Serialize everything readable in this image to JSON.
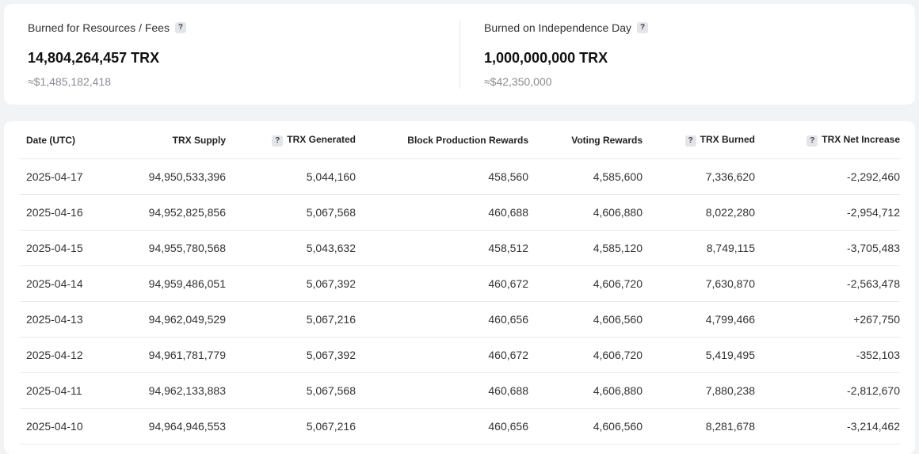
{
  "stats": {
    "resources": {
      "label": "Burned for Resources / Fees",
      "value": "14,804,264,457 TRX",
      "usd": "≈$1,485,182,418"
    },
    "independence": {
      "label": "Burned on Independence Day",
      "value": "1,000,000,000 TRX",
      "usd": "≈$42,350,000"
    },
    "help_glyph": "?"
  },
  "table": {
    "headers": {
      "date": "Date (UTC)",
      "supply": "TRX Supply",
      "generated": "TRX Generated",
      "block_rewards": "Block Production Rewards",
      "voting_rewards": "Voting Rewards",
      "burned": "TRX Burned",
      "net_increase": "TRX Net Increase"
    },
    "rows": [
      {
        "date": "2025-04-17",
        "supply": "94,950,533,396",
        "generated": "5,044,160",
        "block_rewards": "458,560",
        "voting_rewards": "4,585,600",
        "burned": "7,336,620",
        "net_increase": "-2,292,460"
      },
      {
        "date": "2025-04-16",
        "supply": "94,952,825,856",
        "generated": "5,067,568",
        "block_rewards": "460,688",
        "voting_rewards": "4,606,880",
        "burned": "8,022,280",
        "net_increase": "-2,954,712"
      },
      {
        "date": "2025-04-15",
        "supply": "94,955,780,568",
        "generated": "5,043,632",
        "block_rewards": "458,512",
        "voting_rewards": "4,585,120",
        "burned": "8,749,115",
        "net_increase": "-3,705,483"
      },
      {
        "date": "2025-04-14",
        "supply": "94,959,486,051",
        "generated": "5,067,392",
        "block_rewards": "460,672",
        "voting_rewards": "4,606,720",
        "burned": "7,630,870",
        "net_increase": "-2,563,478"
      },
      {
        "date": "2025-04-13",
        "supply": "94,962,049,529",
        "generated": "5,067,216",
        "block_rewards": "460,656",
        "voting_rewards": "4,606,560",
        "burned": "4,799,466",
        "net_increase": "+267,750"
      },
      {
        "date": "2025-04-12",
        "supply": "94,961,781,779",
        "generated": "5,067,392",
        "block_rewards": "460,672",
        "voting_rewards": "4,606,720",
        "burned": "5,419,495",
        "net_increase": "-352,103"
      },
      {
        "date": "2025-04-11",
        "supply": "94,962,133,883",
        "generated": "5,067,568",
        "block_rewards": "460,688",
        "voting_rewards": "4,606,880",
        "burned": "7,880,238",
        "net_increase": "-2,812,670"
      },
      {
        "date": "2025-04-10",
        "supply": "94,964,946,553",
        "generated": "5,067,216",
        "block_rewards": "460,656",
        "voting_rewards": "4,606,560",
        "burned": "8,281,678",
        "net_increase": "-3,214,462"
      }
    ]
  }
}
